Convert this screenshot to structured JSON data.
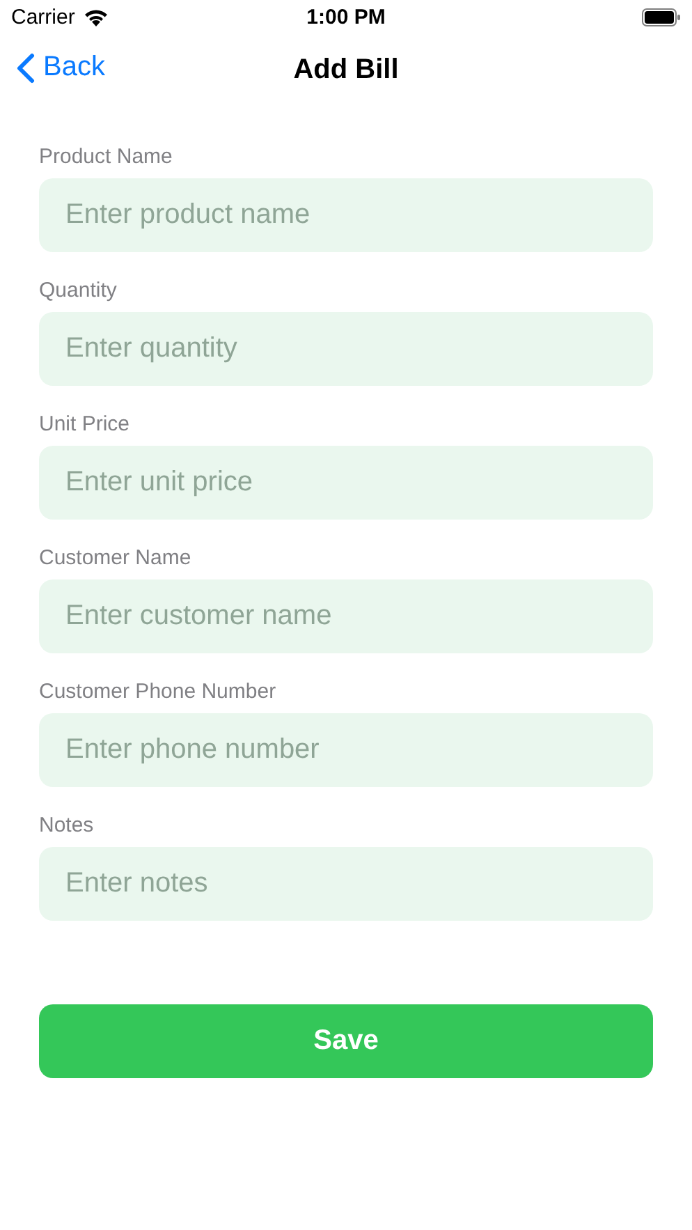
{
  "status_bar": {
    "carrier": "Carrier",
    "time": "1:00 PM"
  },
  "nav": {
    "back": "Back",
    "title": "Add Bill"
  },
  "fields": [
    {
      "label": "Product Name",
      "placeholder": "Enter product name"
    },
    {
      "label": "Quantity",
      "placeholder": "Enter quantity"
    },
    {
      "label": "Unit Price",
      "placeholder": "Enter unit price"
    },
    {
      "label": "Customer Name",
      "placeholder": "Enter customer name"
    },
    {
      "label": "Customer Phone Number",
      "placeholder": "Enter phone number"
    },
    {
      "label": "Notes",
      "placeholder": "Enter notes"
    }
  ],
  "save_button": "Save"
}
